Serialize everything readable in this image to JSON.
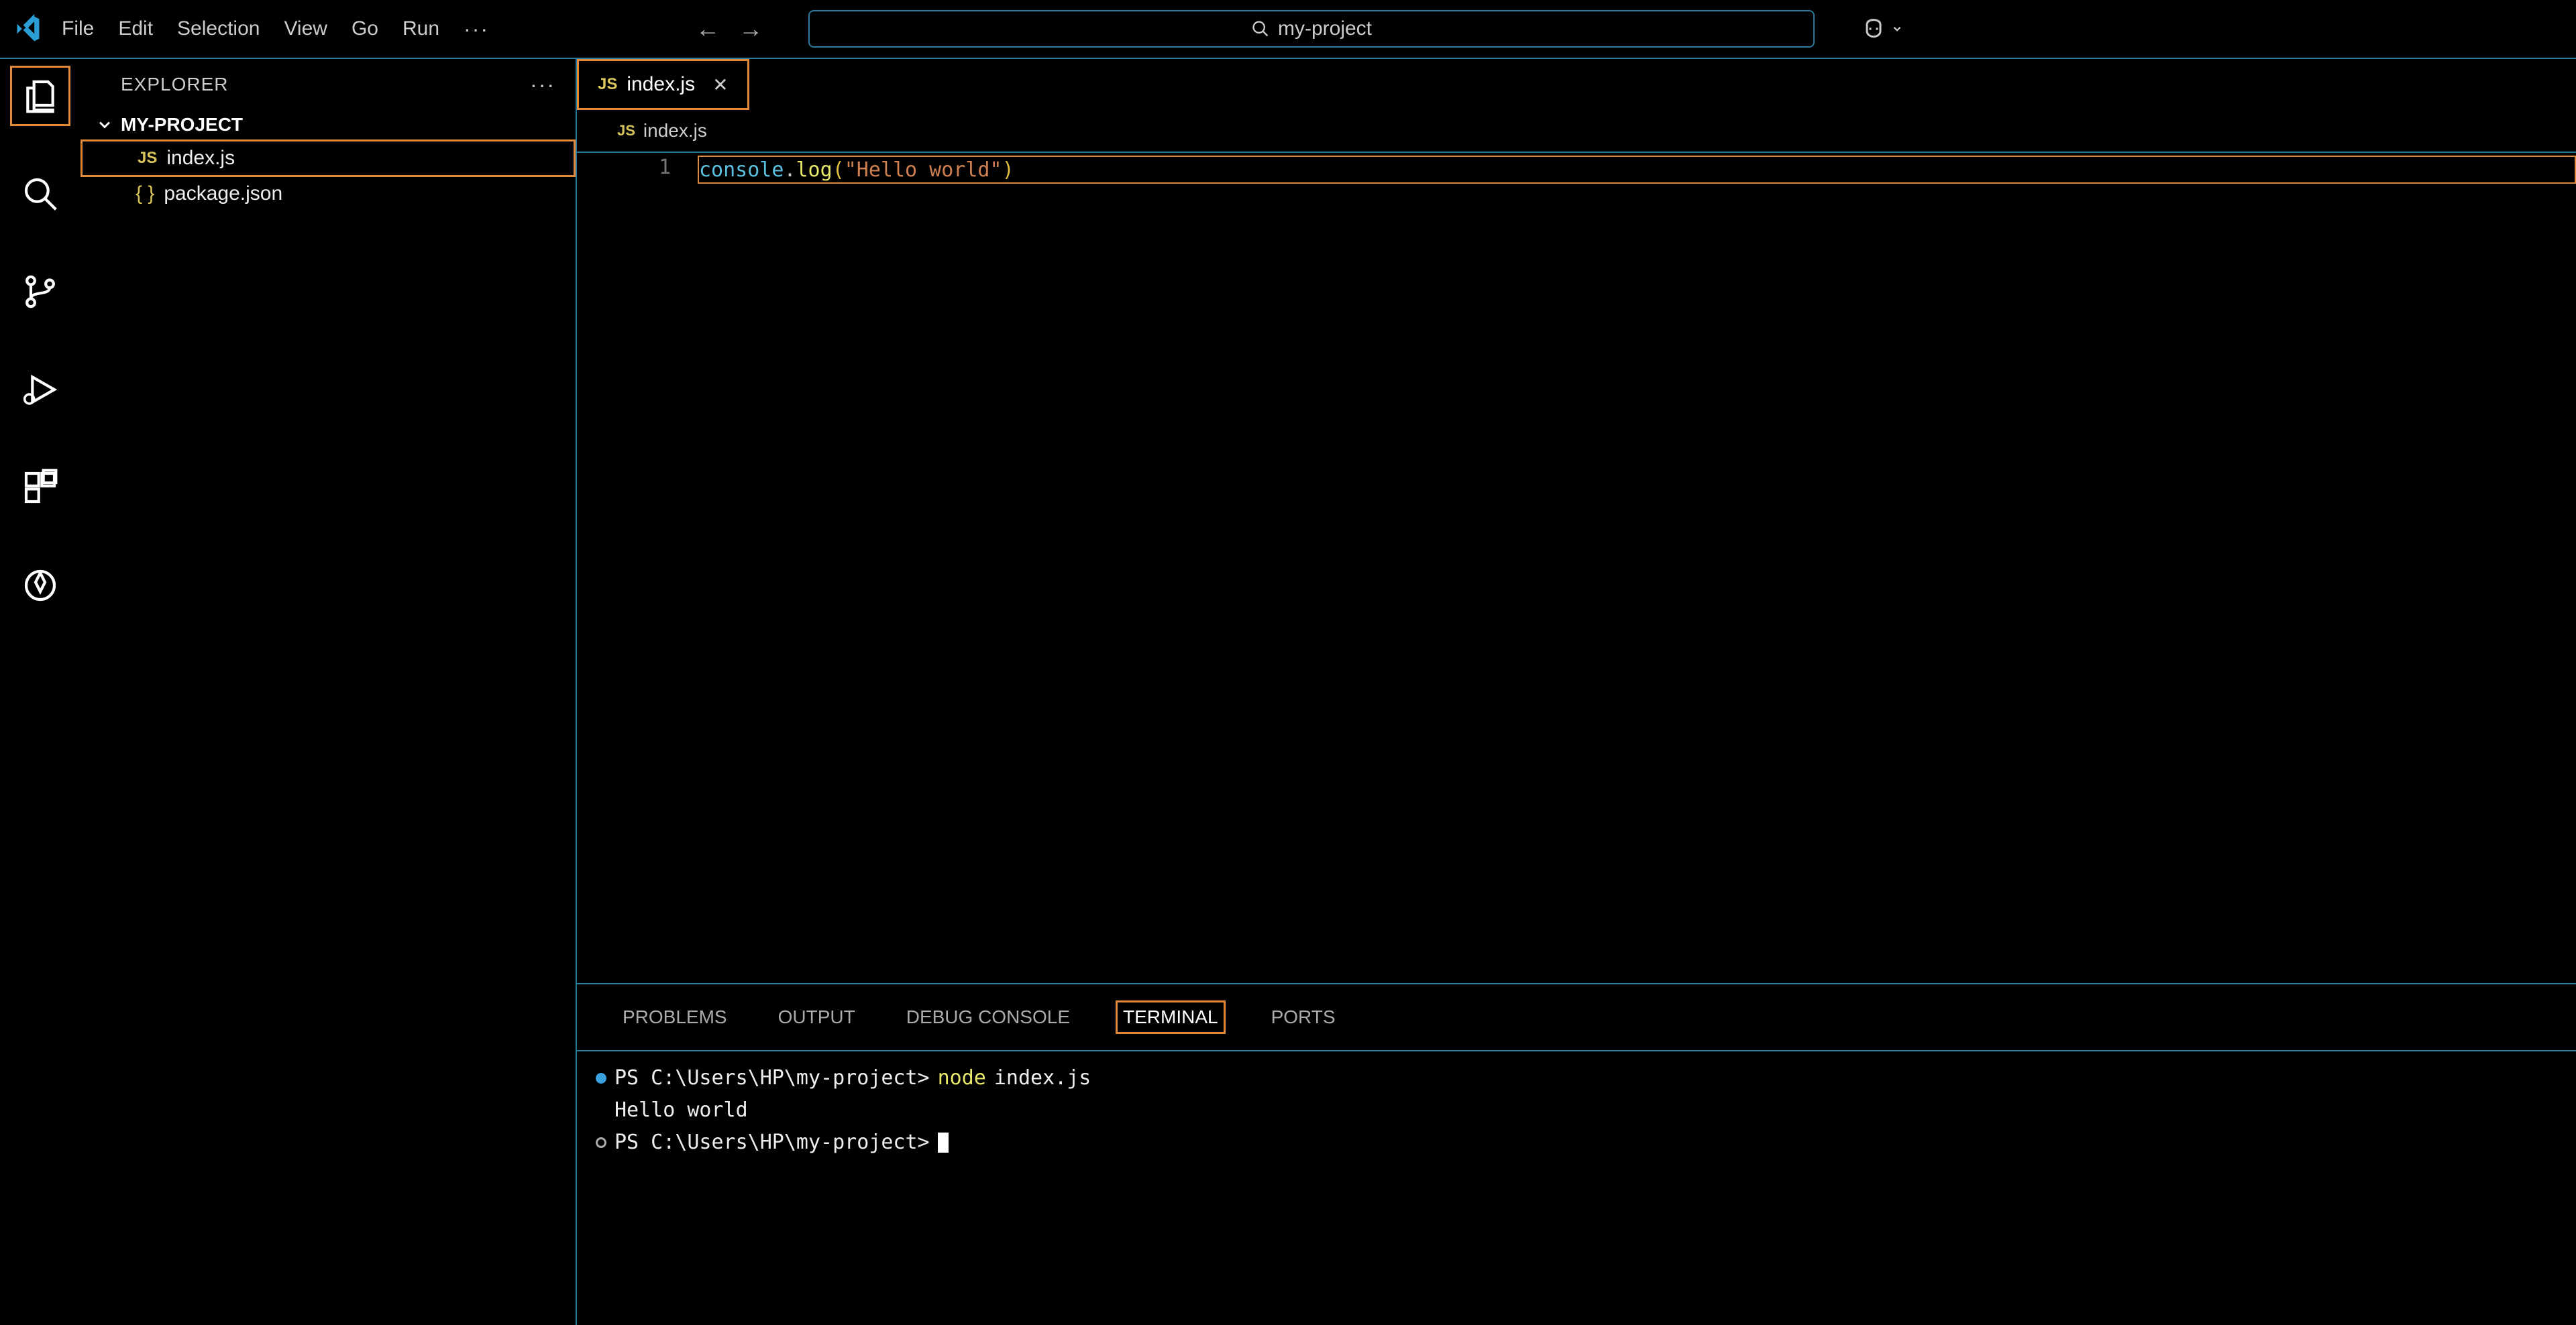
{
  "menubar": {
    "items": [
      "File",
      "Edit",
      "Selection",
      "View",
      "Go",
      "Run"
    ],
    "more": "···"
  },
  "search": {
    "text": "my-project"
  },
  "activity_bar": {
    "items": [
      "explorer",
      "search",
      "source-control",
      "run-debug",
      "extensions",
      "testing"
    ]
  },
  "sidebar": {
    "title": "EXPLORER",
    "more": "···",
    "folder": "MY-PROJECT",
    "files": [
      {
        "icon": "js",
        "name": "index.js",
        "active": true
      },
      {
        "icon": "json",
        "name": "package.json",
        "active": false
      }
    ]
  },
  "tabs": [
    {
      "icon": "js",
      "name": "index.js",
      "active": true
    }
  ],
  "breadcrumb": {
    "icon": "js",
    "text": "index.js"
  },
  "editor": {
    "line_number": "1",
    "tokens": {
      "ident": "console",
      "dot": ".",
      "func": "log",
      "lparen": "(",
      "str": "\"Hello world\"",
      "rparen": ")"
    }
  },
  "panel": {
    "tabs": [
      "PROBLEMS",
      "OUTPUT",
      "DEBUG CONSOLE",
      "TERMINAL",
      "PORTS"
    ],
    "active_tab": "TERMINAL",
    "terminal": {
      "line1_prompt": "PS C:\\Users\\HP\\my-project>",
      "line1_cmd_node": "node",
      "line1_cmd_arg": "index.js",
      "line2_output": "Hello world",
      "line3_prompt": "PS C:\\Users\\HP\\my-project>"
    }
  }
}
